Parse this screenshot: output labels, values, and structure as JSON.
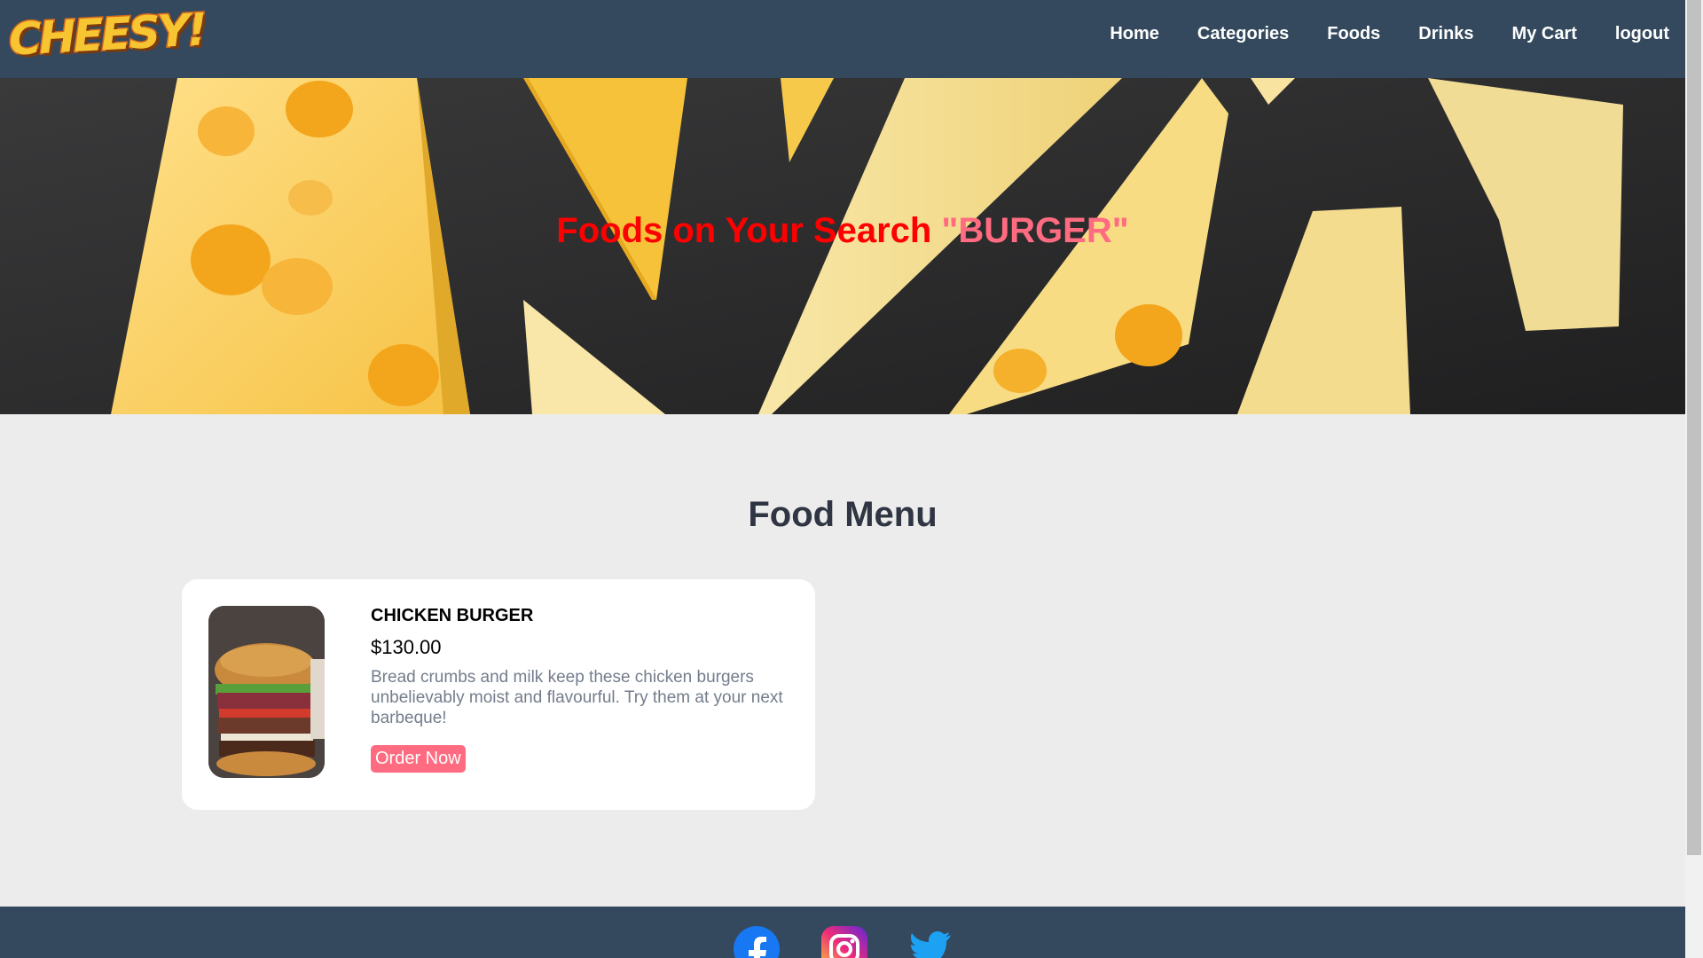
{
  "brand": {
    "logo_text": "CHEESY!"
  },
  "nav": {
    "items": [
      {
        "label": "Home"
      },
      {
        "label": "Categories"
      },
      {
        "label": "Foods"
      },
      {
        "label": "Drinks"
      },
      {
        "label": "My Cart"
      },
      {
        "label": "logout"
      }
    ]
  },
  "hero": {
    "prefix": "Foods on Your Search ",
    "query": "\"BURGER\""
  },
  "menu": {
    "title": "Food Menu",
    "items": [
      {
        "name": "CHICKEN BURGER",
        "price": "$130.00",
        "description": "Bread crumbs and milk keep these chicken burgers unbelievably moist and flavourful. Try them at your next barbeque!",
        "order_label": "Order Now"
      }
    ]
  },
  "footer": {
    "social": [
      {
        "icon": "facebook-icon"
      },
      {
        "icon": "instagram-icon"
      },
      {
        "icon": "twitter-icon"
      }
    ]
  },
  "colors": {
    "nav_bg": "#34495e",
    "accent": "#ff6b81",
    "hero_prefix": "#ff0000",
    "page_bg": "#ececec"
  }
}
